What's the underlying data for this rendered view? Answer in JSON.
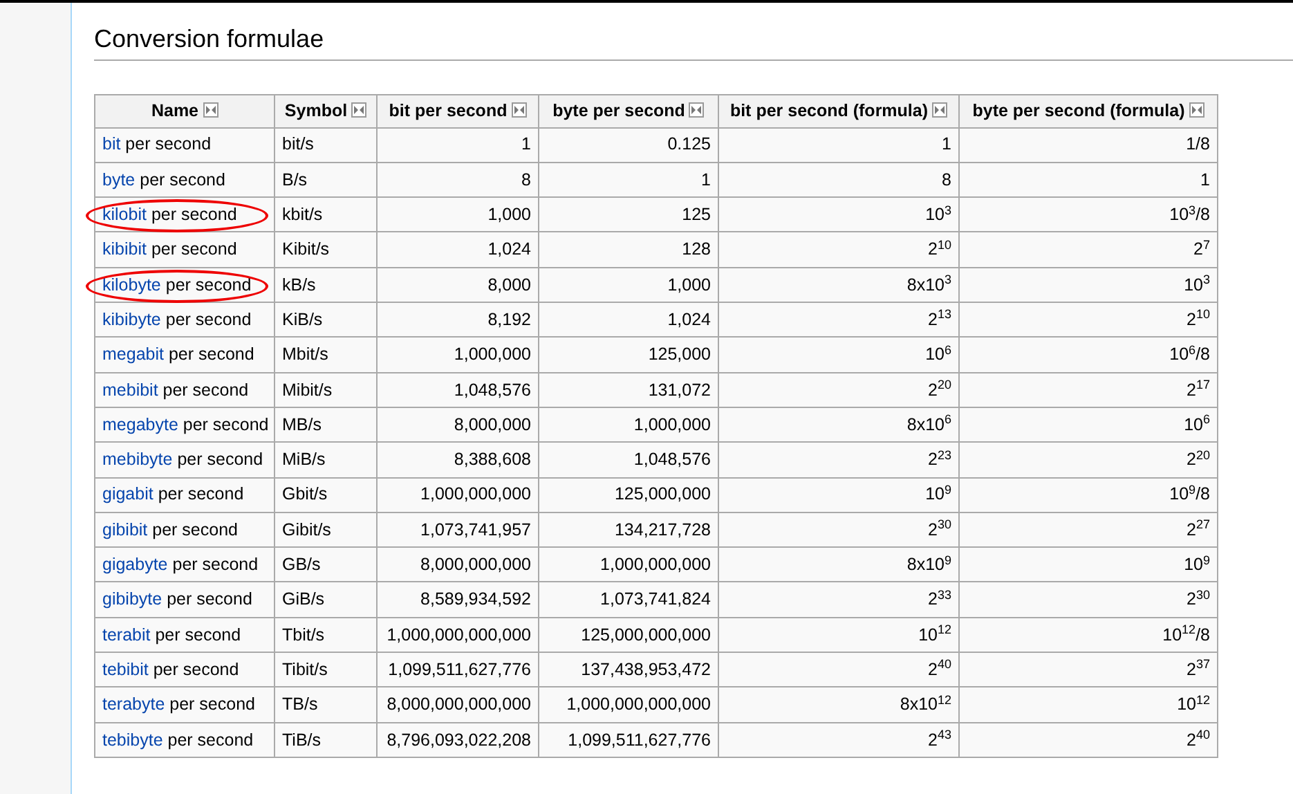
{
  "heading": "Conversion formulae",
  "table": {
    "columns": [
      "Name",
      "Symbol",
      "bit per second",
      "byte per second",
      "bit per second (formula)",
      "byte per second (formula)"
    ],
    "rows": [
      {
        "name_link": "bit",
        "name_rest": "per second",
        "circled": false,
        "symbol": "bit/s",
        "bps": "1",
        "Bps": "0.125",
        "bps_formula": "1",
        "Bps_formula": "1/8"
      },
      {
        "name_link": "byte",
        "name_rest": "per second",
        "circled": false,
        "symbol": "B/s",
        "bps": "8",
        "Bps": "1",
        "bps_formula": "8",
        "Bps_formula": "1"
      },
      {
        "name_link": "kilobit",
        "name_rest": "per second",
        "circled": true,
        "symbol": "kbit/s",
        "bps": "1,000",
        "Bps": "125",
        "bps_formula": "10$^{3}$",
        "Bps_formula": "10$^{3}$/8"
      },
      {
        "name_link": "kibibit",
        "name_rest": "per second",
        "circled": false,
        "symbol": "Kibit/s",
        "bps": "1,024",
        "Bps": "128",
        "bps_formula": "2$^{10}$",
        "Bps_formula": "2$^{7}$"
      },
      {
        "name_link": "kilobyte",
        "name_rest": "per second",
        "circled": true,
        "symbol": "kB/s",
        "bps": "8,000",
        "Bps": "1,000",
        "bps_formula": "8x10$^{3}$",
        "Bps_formula": "10$^{3}$"
      },
      {
        "name_link": "kibibyte",
        "name_rest": "per second",
        "circled": false,
        "symbol": "KiB/s",
        "bps": "8,192",
        "Bps": "1,024",
        "bps_formula": "2$^{13}$",
        "Bps_formula": "2$^{10}$"
      },
      {
        "name_link": "megabit",
        "name_rest": "per second",
        "circled": false,
        "symbol": "Mbit/s",
        "bps": "1,000,000",
        "Bps": "125,000",
        "bps_formula": "10$^{6}$",
        "Bps_formula": "10$^{6}$/8"
      },
      {
        "name_link": "mebibit",
        "name_rest": "per second",
        "circled": false,
        "symbol": "Mibit/s",
        "bps": "1,048,576",
        "Bps": "131,072",
        "bps_formula": "2$^{20}$",
        "Bps_formula": "2$^{17}$"
      },
      {
        "name_link": "megabyte",
        "name_rest": "per second",
        "circled": false,
        "symbol": "MB/s",
        "bps": "8,000,000",
        "Bps": "1,000,000",
        "bps_formula": "8x10$^{6}$",
        "Bps_formula": "10$^{6}$"
      },
      {
        "name_link": "mebibyte",
        "name_rest": "per second",
        "circled": false,
        "symbol": "MiB/s",
        "bps": "8,388,608",
        "Bps": "1,048,576",
        "bps_formula": "2$^{23}$",
        "Bps_formula": "2$^{20}$"
      },
      {
        "name_link": "gigabit",
        "name_rest": "per second",
        "circled": false,
        "symbol": "Gbit/s",
        "bps": "1,000,000,000",
        "Bps": "125,000,000",
        "bps_formula": "10$^{9}$",
        "Bps_formula": "10$^{9}$/8"
      },
      {
        "name_link": "gibibit",
        "name_rest": "per second",
        "circled": false,
        "symbol": "Gibit/s",
        "bps": "1,073,741,957",
        "Bps": "134,217,728",
        "bps_formula": "2$^{30}$",
        "Bps_formula": "2$^{27}$"
      },
      {
        "name_link": "gigabyte",
        "name_rest": "per second",
        "circled": false,
        "symbol": "GB/s",
        "bps": "8,000,000,000",
        "Bps": "1,000,000,000",
        "bps_formula": "8x10$^{9}$",
        "Bps_formula": "10$^{9}$"
      },
      {
        "name_link": "gibibyte",
        "name_rest": "per second",
        "circled": false,
        "symbol": "GiB/s",
        "bps": "8,589,934,592",
        "Bps": "1,073,741,824",
        "bps_formula": "2$^{33}$",
        "Bps_formula": "2$^{30}$"
      },
      {
        "name_link": "terabit",
        "name_rest": "per second",
        "circled": false,
        "symbol": "Tbit/s",
        "bps": "1,000,000,000,000",
        "Bps": "125,000,000,000",
        "bps_formula": "10$^{12}$",
        "Bps_formula": "10$^{12}$/8"
      },
      {
        "name_link": "tebibit",
        "name_rest": "per second",
        "circled": false,
        "symbol": "Tibit/s",
        "bps": "1,099,511,627,776",
        "Bps": "137,438,953,472",
        "bps_formula": "2$^{40}$",
        "Bps_formula": "2$^{37}$"
      },
      {
        "name_link": "terabyte",
        "name_rest": "per second",
        "circled": false,
        "symbol": "TB/s",
        "bps": "8,000,000,000,000",
        "Bps": "1,000,000,000,000",
        "bps_formula": "8x10$^{12}$",
        "Bps_formula": "10$^{12}$"
      },
      {
        "name_link": "tebibyte",
        "name_rest": "per second",
        "circled": false,
        "symbol": "TiB/s",
        "bps": "8,796,093,022,208",
        "Bps": "1,099,511,627,776",
        "bps_formula": "2$^{43}$",
        "Bps_formula": "2$^{40}$"
      }
    ]
  }
}
